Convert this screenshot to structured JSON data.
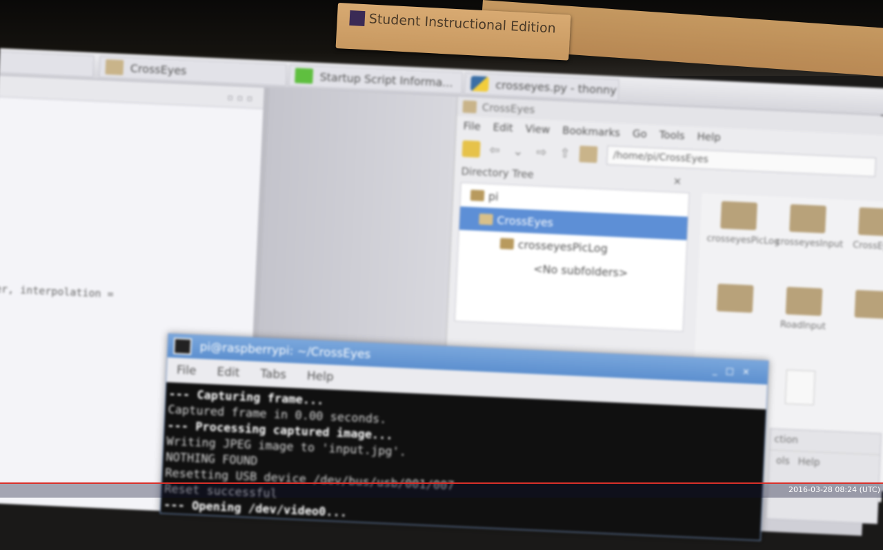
{
  "sticker_text": "Student Instructional Edition",
  "taskbar": {
    "items": [
      {
        "label": "",
        "icon": "window-icon"
      },
      {
        "label": "CrossEyes",
        "icon": "folder-icon"
      },
      {
        "label": "Startup Script Informa...",
        "icon": "leaf-icon"
      },
      {
        "label": "crosseyes.py - thonny",
        "icon": "python-icon"
      }
    ]
  },
  "editor": {
    "code_fragment": "ler, interpolation ="
  },
  "file_manager": {
    "title": "CrossEyes",
    "menu": [
      "File",
      "Edit",
      "View",
      "Bookmarks",
      "Go",
      "Tools",
      "Help"
    ],
    "path": "/home/pi/CrossEyes",
    "dir_tree_header": "Directory Tree",
    "tree": [
      {
        "label": "pi",
        "selected": false,
        "indent": 0
      },
      {
        "label": "CrossEyes",
        "selected": true,
        "indent": 1
      },
      {
        "label": "crosseyesPicLog",
        "selected": false,
        "indent": 2
      },
      {
        "label": "<No subfolders>",
        "selected": false,
        "indent": 3
      }
    ],
    "items": [
      "crosseyesPicLog",
      "crosseyesInput",
      "CrossEyes",
      "",
      "RoadInput",
      ""
    ]
  },
  "terminal": {
    "title": "pi@raspberrypi: ~/CrossEyes",
    "menu": [
      "File",
      "Edit",
      "Tabs",
      "Help"
    ],
    "lines": [
      {
        "text": "--- Capturing frame...",
        "bold": true
      },
      {
        "text": "Captured frame in 0.00 seconds.",
        "bold": false
      },
      {
        "text": "--- Processing captured image...",
        "bold": true
      },
      {
        "text": "Writing JPEG image to 'input.jpg'.",
        "bold": false
      },
      {
        "text": "NOTHING FOUND",
        "bold": false
      },
      {
        "text": "Resetting USB device /dev/bus/usb/001/007",
        "bold": false
      },
      {
        "text": "Reset successful",
        "bold": false
      },
      {
        "text": "--- Opening /dev/video0...",
        "bold": true
      }
    ]
  },
  "file_manager2": {
    "status": "ction",
    "menu": [
      "ols",
      "Help"
    ]
  },
  "timestamp": "2016-03-28 08:24 (UTC)"
}
